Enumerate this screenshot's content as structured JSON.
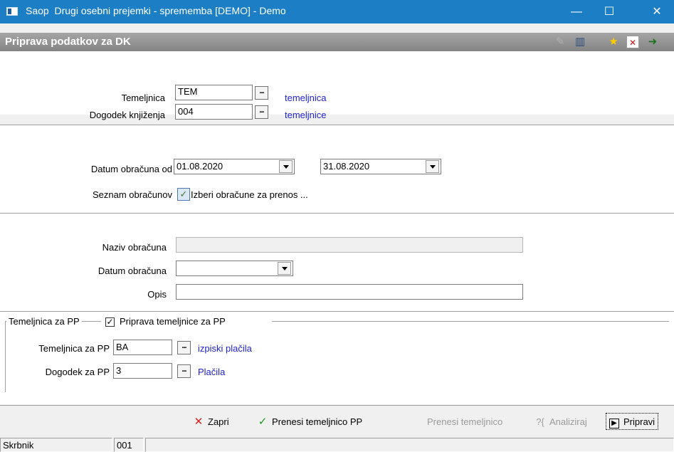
{
  "window": {
    "app_name": "Saop",
    "title": "Drugi osebni prejemki - sprememba [DEMO] - Demo",
    "minimize": "—",
    "maximize": "☐",
    "close": "✕"
  },
  "header": {
    "title": "Priprava podatkov za DK",
    "icons": [
      "edit-icon",
      "columns-icon",
      "star-icon",
      "pdf-icon",
      "exit-icon"
    ]
  },
  "section1": {
    "temeljnica_label": "Temeljnica",
    "temeljnica_value": "TEM",
    "temeljnica_link": "temeljnica",
    "dogodek_label": "Dogodek knjiženja",
    "dogodek_value": "004",
    "dogodek_link": "temeljnice",
    "ellipsis": "..."
  },
  "section2": {
    "datum_label": "Datum obračuna od",
    "datum_od": "01.08.2020",
    "datum_do": "31.08.2020",
    "seznam_label": "Seznam obračunov",
    "seznam_link": "Izberi obračune za prenos ..."
  },
  "section3": {
    "naziv_label": "Naziv obračuna",
    "naziv_value": "",
    "datum_label": "Datum obračuna",
    "datum_value": "",
    "opis_label": "Opis",
    "opis_value": ""
  },
  "section4": {
    "group_label": "Temeljnica za PP",
    "checkbox_label": "Priprava temeljnice za PP",
    "checkbox_checked": true,
    "checkbox_mark": "✓",
    "tem_pp_label": "Temeljnica za PP",
    "tem_pp_value": "BA",
    "tem_pp_link": "izpiski plačila",
    "dog_pp_label": "Dogodek za PP",
    "dog_pp_value": "3",
    "dog_pp_link": "Plačila"
  },
  "footer": {
    "zapri": "Zapri",
    "prenesi_pp": "Prenesi temeljnico PP",
    "prenesi": "Prenesi temeljnico",
    "analiziraj": "Analiziraj",
    "analiziraj_icon": "?{",
    "pripravi": "Pripravi"
  },
  "statusbar": {
    "user_label": "Skrbnik",
    "code": "001",
    "extra": ""
  },
  "colors": {
    "titlebar": "#1c7fc6",
    "link": "#2222cc",
    "close_x": "#e02020",
    "check": "#1a9a1a"
  }
}
